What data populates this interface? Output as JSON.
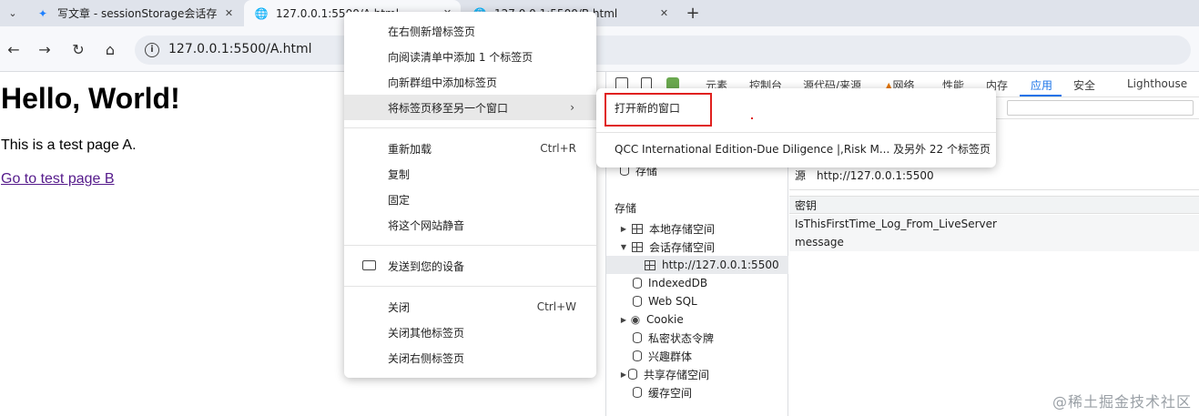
{
  "tabs": [
    {
      "title": "写文章 - sessionStorage会话存",
      "favicon": "juejin-icon"
    },
    {
      "title": "127.0.0.1:5500/A.html",
      "favicon": "globe-icon"
    },
    {
      "title": "127.0.0.1:5500/B.html",
      "favicon": "globe-icon"
    }
  ],
  "toolbar": {
    "url": "127.0.0.1:5500/A.html"
  },
  "page": {
    "heading": "Hello, World!",
    "paragraph": "This is a test page A.",
    "link": "Go to test page B"
  },
  "devtools": {
    "tabs": [
      "元素",
      "控制台",
      "源代码/来源",
      "网络",
      "性能",
      "内存",
      "应用",
      "安全",
      "Lighthouse"
    ],
    "active_tab": "应用",
    "sidebar": {
      "partial_item": "存储",
      "section": "存储",
      "items": [
        "本地存储空间",
        "会话存储空间",
        "http://127.0.0.1:5500",
        "IndexedDB",
        "Web SQL",
        "Cookie",
        "私密状态令牌",
        "兴趣群体",
        "共享存储空间",
        "缓存空间"
      ]
    },
    "origin_label": "源",
    "origin_value": "http://127.0.0.1:5500",
    "table_header": "密钥",
    "rows": [
      "IsThisFirstTime_Log_From_LiveServer",
      "message"
    ]
  },
  "context_menu": {
    "items": [
      {
        "label": "在右侧新增标签页"
      },
      {
        "label": "向阅读清单中添加 1 个标签页"
      },
      {
        "label": "向新群组中添加标签页"
      },
      {
        "label": "将标签页移至另一个窗口"
      },
      {
        "label": "重新加载",
        "shortcut": "Ctrl+R"
      },
      {
        "label": "复制"
      },
      {
        "label": "固定"
      },
      {
        "label": "将这个网站静音"
      },
      {
        "label": "发送到您的设备"
      },
      {
        "label": "关闭",
        "shortcut": "Ctrl+W"
      },
      {
        "label": "关闭其他标签页"
      },
      {
        "label": "关闭右侧标签页"
      }
    ]
  },
  "submenu": {
    "items": [
      "打开新的窗口",
      "QCC International Edition-Due Diligence |,Risk M... 及另外 22 个标签页"
    ]
  },
  "watermark": "@稀土掘金技术社区",
  "colors": {
    "accent": "#1a73e8",
    "highlight_border": "#e0201e"
  }
}
